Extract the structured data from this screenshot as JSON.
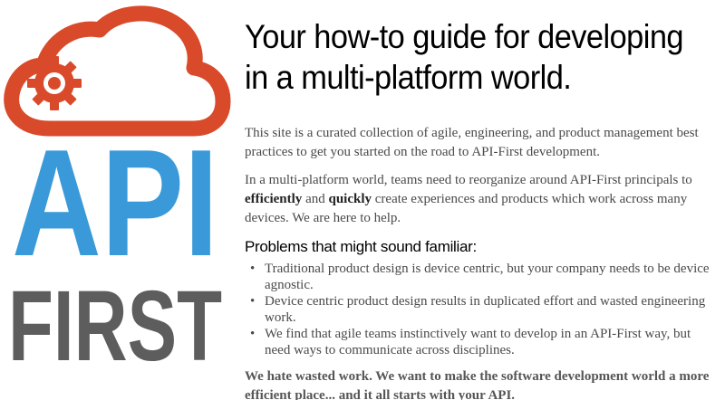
{
  "logo": {
    "line1": "API",
    "line2": "FIRST",
    "colors": {
      "cloud": "#d94a2b",
      "api": "#3a9ad9",
      "first": "#5d5d5d"
    },
    "icon": "cloud-gear-icon"
  },
  "headline": {
    "line1": "Your how-to guide for developing",
    "line2": "in a multi-platform world."
  },
  "intro": "This site is a curated collection of agile, engineering, and product management best practices to get you started on the road to API-First development.",
  "second": {
    "before": "In a multi-platform world, teams need to reorganize around API-First principals to ",
    "bold1": "efficiently",
    "middle": " and ",
    "bold2": "quickly",
    "after": " create experiences and products which work across many devices. We are here to help."
  },
  "problems": {
    "title": "Problems that might sound familiar:",
    "bullet": "•",
    "items": [
      "Traditional product design is device centric, but your company needs to be device agnostic.",
      "Device centric product design results in duplicated effort and wasted engineering work.",
      "We find that agile teams instinctively want to develop in an API-First way, but need ways to communicate across disciplines."
    ]
  },
  "closing": "We hate wasted work. We want to make the software development world a more efficient place... and it all starts with your API."
}
